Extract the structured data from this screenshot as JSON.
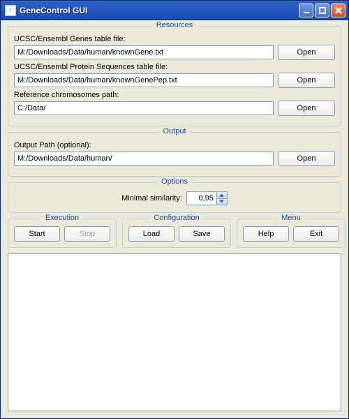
{
  "window": {
    "title": "GeneControl GUI"
  },
  "resources": {
    "title": "Resources",
    "genes_label": "UCSC/Ensembl Genes table file:",
    "genes_value": "M:/Downloads/Data/human/knownGene.txt",
    "proteins_label": "UCSC/Ensembl Protein Sequences table file:",
    "proteins_value": "M:/Downloads/Data/human/knownGenePep.txt",
    "chrom_label": "Reference chromosomes path:",
    "chrom_value": "C:/Data/",
    "open_label": "Open"
  },
  "output": {
    "title": "Output",
    "path_label": "Output Path (optional):",
    "path_value": "M:/Downloads/Data/human/",
    "open_label": "Open"
  },
  "options": {
    "title": "Options",
    "similarity_label": "Minimal similarity:",
    "similarity_value": "0,95"
  },
  "execution": {
    "title": "Execution",
    "start_label": "Start",
    "stop_label": "Stop"
  },
  "configuration": {
    "title": "Configuration",
    "load_label": "Load",
    "save_label": "Save"
  },
  "menu": {
    "title": "Menu",
    "help_label": "Help",
    "exit_label": "Exit"
  }
}
